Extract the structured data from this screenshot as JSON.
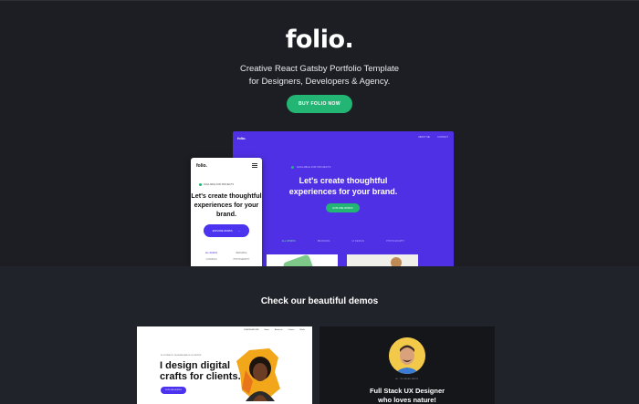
{
  "hero": {
    "logo": "folio.",
    "tagline_line1": "Creative React Gatsby Portfolio Template",
    "tagline_line2": "for Designers, Developers & Agency.",
    "buy_button": "BUY FOLIO NOW"
  },
  "desktop_preview": {
    "logo": "folio.",
    "nav": [
      "ABOUT ME",
      "CONTACT"
    ],
    "tag": "AVAILABLE FOR PROJECTS",
    "heading_line1": "Let's create thoughtful",
    "heading_line2": "experiences for your brand.",
    "button": "EXPLORE WORKS",
    "filters": [
      "ALL WORKS",
      "BRANDING",
      "UI DESIGN",
      "PHOTOGRAPHY"
    ]
  },
  "mobile_preview": {
    "logo": "folio.",
    "tag": "AVAILABLE FOR PROJECTS",
    "heading_line1": "Let's create thoughtful",
    "heading_line2": "experiences for your",
    "heading_line3": "brand.",
    "button": "EXPLORE WORKS",
    "button_arrow": "→",
    "filters": [
      "ALL WORKS",
      "BRANDING",
      "UI DESIGN",
      "PHOTOGRAPHY"
    ]
  },
  "demos": {
    "title": "Check our beautiful demos",
    "card1": {
      "nav": [
        "CLAUDIA MOORE",
        "Home",
        "About me",
        "Contact",
        "Works"
      ],
      "tag": "ILLUSTRATOR, DESIGNER AND BLOG WRITER",
      "heading_line1": "I design digital",
      "heading_line2": "crafts for clients.",
      "button": "EXPLORE WORKS"
    },
    "card2": {
      "tag": "HI, I'M BRIAN SMITH",
      "heading_line1": "Full Stack UX Designer",
      "heading_line2": "who loves nature!"
    }
  },
  "colors": {
    "background": "#1c1e23",
    "accent_green": "#22b573",
    "accent_purple": "#5030e5"
  }
}
